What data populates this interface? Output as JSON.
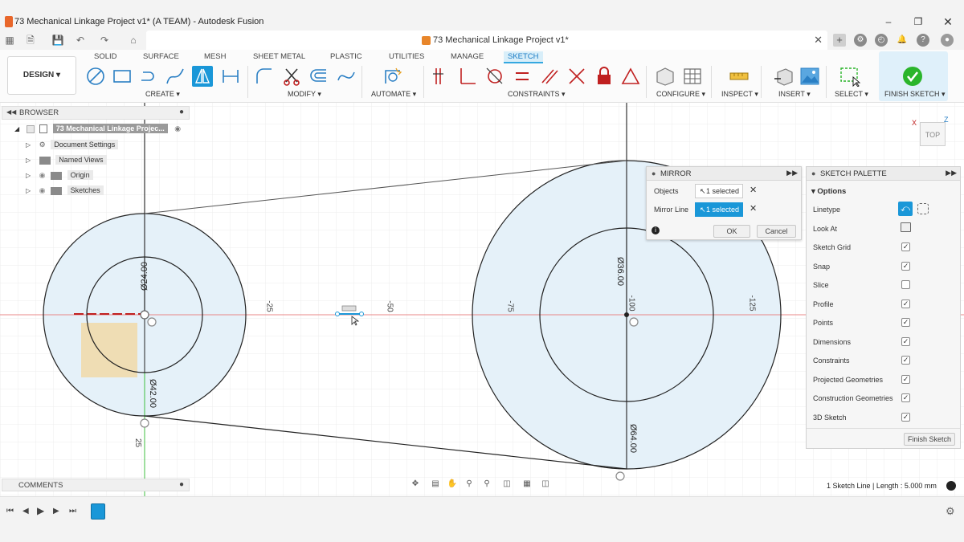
{
  "window": {
    "title": "73 Mechanical Linkage Project v1* (A TEAM) - Autodesk Fusion",
    "doc_tab_title": "73 Mechanical Linkage Project v1*"
  },
  "ribbon": {
    "workspace_button": "DESIGN",
    "tabs": [
      "SOLID",
      "SURFACE",
      "MESH",
      "SHEET METAL",
      "PLASTIC",
      "UTILITIES",
      "MANAGE",
      "SKETCH"
    ],
    "active_tab": "SKETCH",
    "groups": {
      "create": "CREATE",
      "modify": "MODIFY",
      "automate": "AUTOMATE",
      "constraints": "CONSTRAINTS",
      "configure": "CONFIGURE",
      "inspect": "INSPECT",
      "insert": "INSERT",
      "select": "SELECT",
      "finish": "FINISH SKETCH"
    }
  },
  "browser": {
    "title": "BROWSER",
    "root": "73 Mechanical Linkage Projec...",
    "items": [
      "Document Settings",
      "Named Views",
      "Origin",
      "Sketches"
    ]
  },
  "comments": {
    "title": "COMMENTS"
  },
  "mirror_dialog": {
    "title": "MIRROR",
    "objects_label": "Objects",
    "objects_value": "1 selected",
    "mirror_line_label": "Mirror Line",
    "mirror_line_value": "1 selected",
    "ok_label": "OK",
    "cancel_label": "Cancel"
  },
  "sketch_palette": {
    "title": "SKETCH PALETTE",
    "section": "Options",
    "options": [
      {
        "label": "Linetype",
        "kind": "icons"
      },
      {
        "label": "Look At",
        "kind": "icon"
      },
      {
        "label": "Sketch Grid",
        "checked": true
      },
      {
        "label": "Snap",
        "checked": true
      },
      {
        "label": "Slice",
        "checked": false
      },
      {
        "label": "Profile",
        "checked": true
      },
      {
        "label": "Points",
        "checked": true
      },
      {
        "label": "Dimensions",
        "checked": true
      },
      {
        "label": "Constraints",
        "checked": true
      },
      {
        "label": "Projected Geometries",
        "checked": true
      },
      {
        "label": "Construction Geometries",
        "checked": true
      },
      {
        "label": "3D Sketch",
        "checked": true
      }
    ],
    "finish_button": "Finish Sketch"
  },
  "canvas": {
    "dimensions": [
      "Ø24.00",
      "Ø42.00",
      "Ø36.00",
      "Ø64.00"
    ],
    "axis_ticks": [
      "-25",
      "-50",
      "-75",
      "-100",
      "-125",
      "25"
    ],
    "viewcube_label": "TOP",
    "axis_x": "X",
    "axis_z": "Z"
  },
  "status": {
    "text": "1 Sketch Line | Length : 5.000 mm"
  },
  "colors": {
    "accent": "#1a97d8",
    "finish_green": "#2bb52b",
    "profile_fill": "#e5f1f9",
    "highlight_fill": "#f1d9a8",
    "x_axis_red": "#e05050",
    "y_axis_green": "#3fbf3f"
  }
}
